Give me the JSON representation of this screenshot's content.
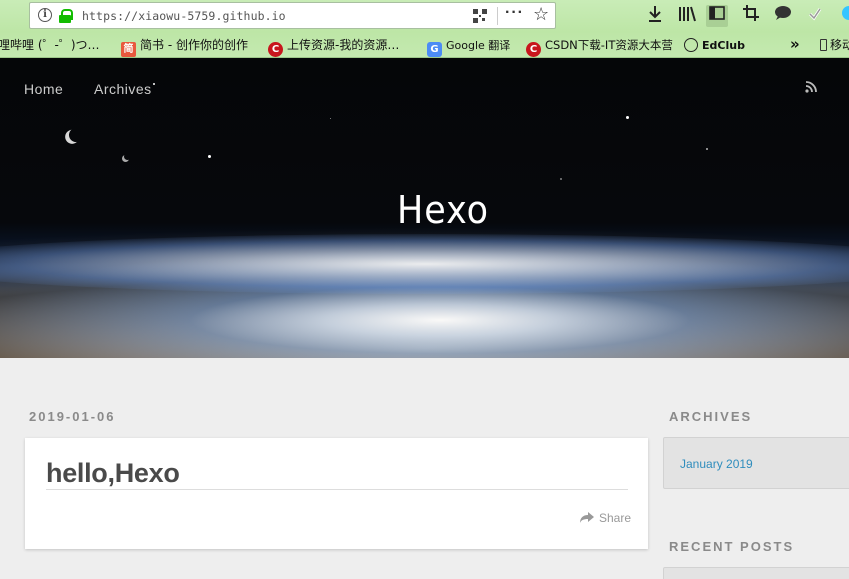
{
  "browser": {
    "url": "https://xiaowu-5759.github.io",
    "toolbar_icons": [
      "downloads-icon",
      "library-icon",
      "sidebar-icon",
      "screenshot-icon",
      "chat-icon",
      "sync-icon",
      "extension-icon"
    ]
  },
  "bookmarks": [
    {
      "label": "哩哔哩 (゜-゜)つ…",
      "icon": "none"
    },
    {
      "label": "简书 - 创作你的创作",
      "icon": "jianshu-icon",
      "glyph": "简"
    },
    {
      "label": "上传资源-我的资源…",
      "icon": "csdn-icon",
      "glyph": "C"
    },
    {
      "label": "Google 翻译",
      "icon": "google-translate-icon",
      "glyph": "G"
    },
    {
      "label": "CSDN下载-IT资源大本营",
      "icon": "csdn-icon",
      "glyph": "C"
    },
    {
      "label": "EdClub",
      "icon": "globe-icon",
      "glyph": ""
    },
    {
      "label": "»",
      "icon": "none"
    },
    {
      "label": "移动",
      "icon": "mobile-icon"
    }
  ],
  "site": {
    "nav": [
      "Home",
      "Archives"
    ],
    "title": "Hexo"
  },
  "post": {
    "date": "2019-01-06",
    "title": "hello,Hexo",
    "share_label": "Share"
  },
  "sidebar": {
    "archives_heading": "ARCHIVES",
    "archives_items": [
      "January 2019"
    ],
    "recent_heading": "RECENT POSTS"
  },
  "colors": {
    "browser_chrome": "#c4e9b0",
    "page_bg": "#eeeeee",
    "link": "#2f8dbd",
    "muted_text": "#8a8a8a"
  }
}
